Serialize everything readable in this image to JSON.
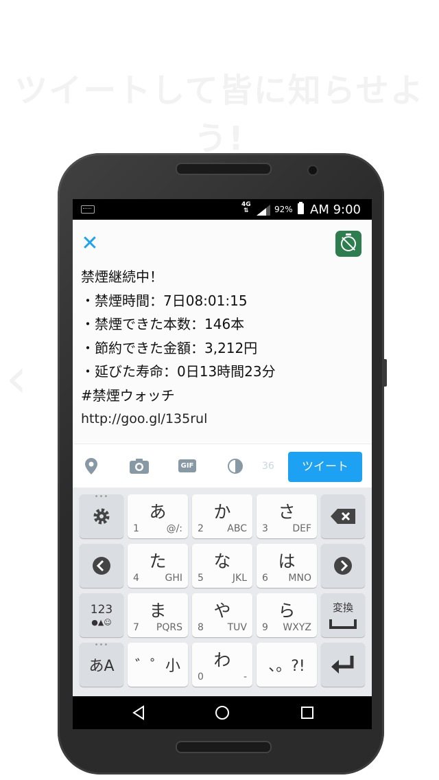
{
  "headline": "ツイートして皆に知らせよう!",
  "status": {
    "network": "4G",
    "battery": "92%",
    "clock": "AM 9:00"
  },
  "compose": {
    "lines": [
      "禁煙継続中！",
      "・禁煙時間：7日08:01:15",
      "・禁煙できた本数：146本",
      "・節約できた金額：3,212円",
      "・延びた寿命：0日13時間23分",
      "#禁煙ウォッチ",
      "http://goo.gl/135rul"
    ],
    "char_count": "36",
    "tweet_button": "ツイート"
  },
  "keyboard": {
    "keys": [
      {
        "main": "あ",
        "num": "1",
        "sub": "@/:"
      },
      {
        "main": "か",
        "num": "2",
        "sub": "ABC"
      },
      {
        "main": "さ",
        "num": "3",
        "sub": "DEF"
      },
      {
        "main": "た",
        "num": "4",
        "sub": "GHI"
      },
      {
        "main": "な",
        "num": "5",
        "sub": "JKL"
      },
      {
        "main": "は",
        "num": "6",
        "sub": "MNO"
      },
      {
        "main": "ま",
        "num": "7",
        "sub": "PQRS"
      },
      {
        "main": "や",
        "num": "8",
        "sub": "TUV"
      },
      {
        "main": "ら",
        "num": "9",
        "sub": "WXYZ"
      },
      {
        "main": "゛゜小",
        "num": "",
        "sub": ""
      },
      {
        "main": "わ",
        "num": "0",
        "sub": "-"
      },
      {
        "main": "、。?!",
        "num": "",
        "sub": ""
      }
    ],
    "num_mode": "123",
    "num_mode_sub": "●▲☺",
    "kana_mode": "あA",
    "henkan": "変換"
  },
  "colors": {
    "accent": "#1da1f2",
    "app_icon": "#2e7d4f",
    "phone": "#2b2b2b"
  }
}
